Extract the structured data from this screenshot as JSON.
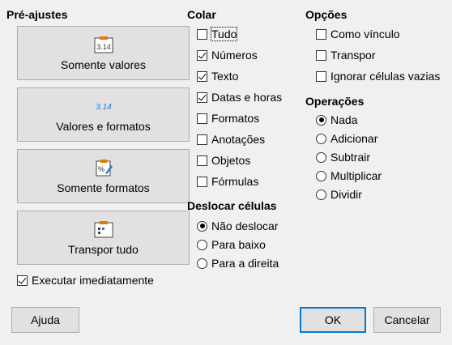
{
  "presets": {
    "title": "Pré-ajustes",
    "buttons": [
      {
        "label": "Somente valores",
        "icon": "values-icon"
      },
      {
        "label": "Valores e formatos",
        "icon": "values-formats-icon"
      },
      {
        "label": "Somente formatos",
        "icon": "formats-icon"
      },
      {
        "label": "Transpor tudo",
        "icon": "transpose-icon"
      }
    ],
    "run_immediately": {
      "label": "Executar imediatamente",
      "checked": true
    }
  },
  "paste": {
    "title": "Colar",
    "items": [
      {
        "label": "Tudo",
        "checked": false
      },
      {
        "label": "Números",
        "checked": true
      },
      {
        "label": "Texto",
        "checked": true
      },
      {
        "label": "Datas e horas",
        "checked": true
      },
      {
        "label": "Formatos",
        "checked": false
      },
      {
        "label": "Anotações",
        "checked": false
      },
      {
        "label": "Objetos",
        "checked": false
      },
      {
        "label": "Fórmulas",
        "checked": false
      }
    ]
  },
  "shift": {
    "title": "Deslocar células",
    "items": [
      {
        "label": "Não deslocar",
        "selected": true
      },
      {
        "label": "Para baixo",
        "selected": false
      },
      {
        "label": "Para a direita",
        "selected": false
      }
    ]
  },
  "options": {
    "title": "Opções",
    "items": [
      {
        "label": "Como vínculo",
        "checked": false
      },
      {
        "label": "Transpor",
        "checked": false
      },
      {
        "label": "Ignorar células vazias",
        "checked": false
      }
    ]
  },
  "operations": {
    "title": "Operações",
    "items": [
      {
        "label": "Nada",
        "selected": true
      },
      {
        "label": "Adicionar",
        "selected": false
      },
      {
        "label": "Subtrair",
        "selected": false
      },
      {
        "label": "Multiplicar",
        "selected": false
      },
      {
        "label": "Dividir",
        "selected": false
      }
    ]
  },
  "footer": {
    "help": "Ajuda",
    "ok": "OK",
    "cancel": "Cancelar"
  },
  "preset_icon_text": {
    "values": "3.14",
    "values_formats": "3.14",
    "formats": "%"
  },
  "colors": {
    "dialog_bg": "#f0f0f0",
    "button_bg": "#e1e1e1",
    "accent": "#0078d7",
    "icon_orange": "#e07b00",
    "icon_blue": "#2a7ad5"
  }
}
